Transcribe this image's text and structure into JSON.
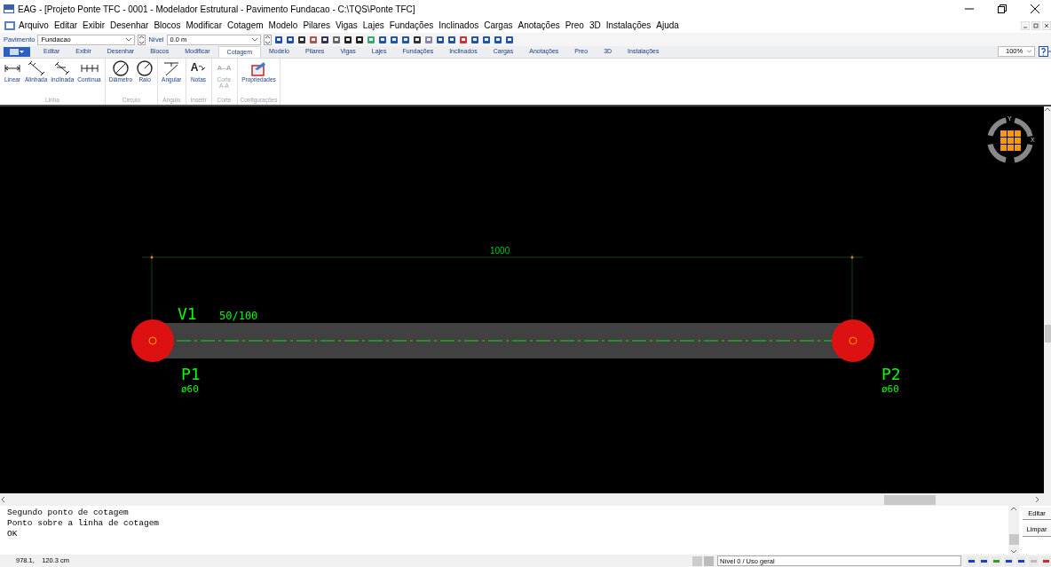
{
  "window": {
    "title": "EAG - [Projeto Ponte TFC - 0001 - Modelador Estrutural - Pavimento Fundacao - C:\\TQS\\Ponte TFC]"
  },
  "menu": [
    "Arquivo",
    "Editar",
    "Exibir",
    "Desenhar",
    "Blocos",
    "Modificar",
    "Cotagem",
    "Modelo",
    "Pilares",
    "Vigas",
    "Lajes",
    "Fundações",
    "Inclinados",
    "Cargas",
    "Anotações",
    "Preo",
    "3D",
    "Instalações",
    "Ajuda"
  ],
  "toolbar": {
    "pavimento_label": "Pavimento",
    "pavimento": "Fundacao",
    "nivel_label": "Nível",
    "nivel": "0.0 m"
  },
  "ribbon_tabs": [
    {
      "label": "Editar",
      "selected": false
    },
    {
      "label": "Exibir",
      "selected": false
    },
    {
      "label": "Desenhar",
      "selected": false
    },
    {
      "label": "Blocos",
      "selected": false
    },
    {
      "label": "Modificar",
      "selected": false
    },
    {
      "label": "Cotagem",
      "selected": true
    },
    {
      "label": "Modelo",
      "selected": false
    },
    {
      "label": "Pilares",
      "selected": false
    },
    {
      "label": "Vigas",
      "selected": false
    },
    {
      "label": "Lajes",
      "selected": false
    },
    {
      "label": "Fundações",
      "selected": false
    },
    {
      "label": "Inclinados",
      "selected": false
    },
    {
      "label": "Cargas",
      "selected": false
    },
    {
      "label": "Anotações",
      "selected": false
    },
    {
      "label": "Preo",
      "selected": false
    },
    {
      "label": "3D",
      "selected": false
    },
    {
      "label": "Instalações",
      "selected": false
    }
  ],
  "zoom": "100%",
  "ribbon_groups": [
    {
      "title": "Linha",
      "buttons": [
        {
          "kind": "linear",
          "label": "Linear",
          "disabled": false
        },
        {
          "kind": "aligned",
          "label": "Alinhada",
          "disabled": false
        },
        {
          "kind": "inclined",
          "label": "Inclinada",
          "disabled": false
        },
        {
          "kind": "continuous",
          "label": "Contínua",
          "disabled": false
        }
      ]
    },
    {
      "title": "Circulo",
      "buttons": [
        {
          "kind": "diameter",
          "label": "Diâmetro",
          "disabled": false
        },
        {
          "kind": "radius",
          "label": "Raio",
          "disabled": false
        }
      ]
    },
    {
      "title": "Angulo",
      "buttons": [
        {
          "kind": "angle",
          "label": "Angular",
          "disabled": false
        }
      ]
    },
    {
      "title": "Inserir",
      "buttons": [
        {
          "kind": "notes",
          "glyph": "A",
          "label": "Notas",
          "disabled": false
        }
      ]
    },
    {
      "title": "Corte",
      "buttons": [
        {
          "kind": "section",
          "glyph": "A–A",
          "label": "Corte A-A",
          "disabled": true
        }
      ]
    },
    {
      "title": "Configurações",
      "buttons": [
        {
          "kind": "properties",
          "label": "Propriedades",
          "disabled": false
        }
      ]
    }
  ],
  "canvas": {
    "dimension": "1000",
    "beam": {
      "name": "V1",
      "section": "50/100"
    },
    "pillars": [
      {
        "name": "P1",
        "diameter": "ø60"
      },
      {
        "name": "P2",
        "diameter": "ø60"
      }
    ],
    "view_cube": {
      "y_label": "Y",
      "x_label": "X"
    }
  },
  "command_lines": [
    "Segundo ponto de cotagem",
    "Ponto sobre a linha de cotagem",
    "OK"
  ],
  "command_buttons": [
    "Editar",
    "Limpar"
  ],
  "status_bar": {
    "coordinates": "978.1,    120.3 cm",
    "layer": "Nível 0 / Uso geral"
  }
}
